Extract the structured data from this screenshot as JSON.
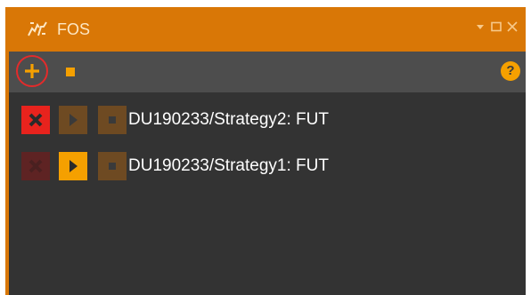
{
  "window": {
    "title": "FOS"
  },
  "toolbar": {
    "add_icon": "plus-icon",
    "stop_icon": "stop-icon",
    "help_icon": "question-mark-icon",
    "help_glyph": "?"
  },
  "strategies": [
    {
      "label": "DU190233/Strategy2: FUT",
      "remove_enabled": true,
      "play_enabled": false,
      "stop_enabled": false
    },
    {
      "label": "DU190233/Strategy1: FUT",
      "remove_enabled": false,
      "play_enabled": true,
      "stop_enabled": false
    }
  ],
  "colors": {
    "accent_orange": "#d97706",
    "button_orange": "#f5a000",
    "remove_red": "#e8231d",
    "panel_dark": "#333333",
    "toolbar_gray": "#4d4d4d",
    "highlight_circle": "#e32b2b"
  }
}
